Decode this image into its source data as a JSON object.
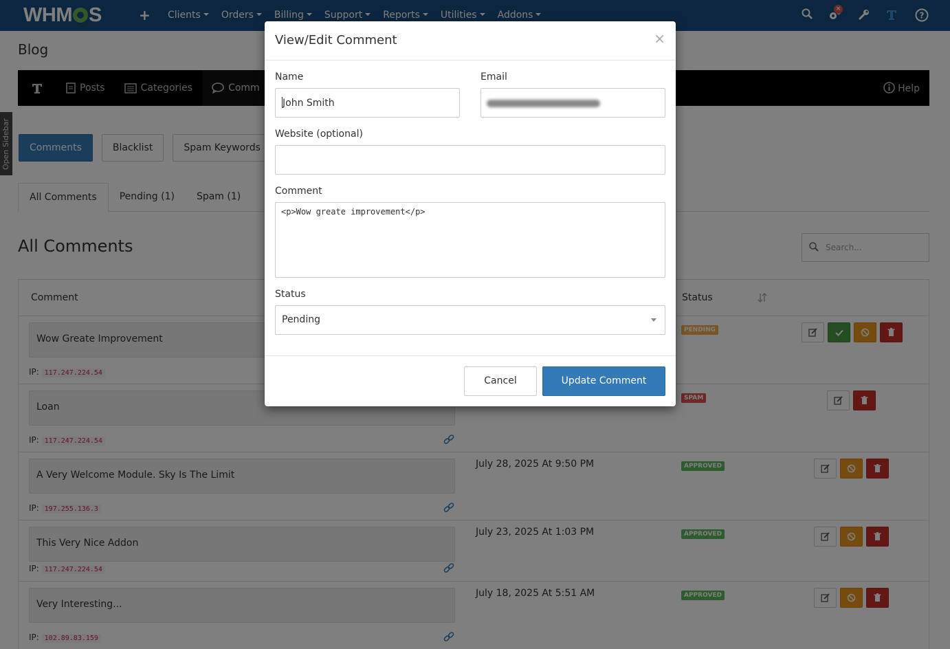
{
  "topnav": {
    "logo": "WHM",
    "logo_end": "S",
    "menu": [
      "Clients",
      "Orders",
      "Billing",
      "Support",
      "Reports",
      "Utilities",
      "Addons"
    ],
    "notification_badge": "×",
    "bg_color": "#1a4d80"
  },
  "page": {
    "title": "Blog",
    "open_sidebar": "Open Sidebar",
    "subnav": {
      "items": [
        "Posts",
        "Categories",
        "Comm"
      ],
      "help": "Help"
    },
    "button_tabs": [
      "Comments",
      "Blacklist",
      "Spam Keywords"
    ],
    "tabs": [
      "All Comments",
      "Pending (1)",
      "Spam (1)"
    ],
    "heading": "All Comments",
    "search_placeholder": "Search...",
    "table": {
      "headers": [
        "Comment",
        "Status"
      ],
      "ip_label": "IP:",
      "rows": [
        {
          "comment": "Wow Greate Improvement",
          "ip": "117.247.224.54",
          "date": "",
          "status": "PENDING",
          "status_color": "#f0ad4e"
        },
        {
          "comment": "Loan",
          "ip": "117.247.224.54",
          "date": "",
          "status": "SPAM",
          "status_color": "#d9534f"
        },
        {
          "comment": "A Very Welcome Module. Sky Is The Limit",
          "ip": "197.255.136.3",
          "date": "July 28, 2025 At 9:50 PM",
          "status": "APPROVED",
          "status_color": "#5cb85c"
        },
        {
          "comment": "This Very Nice Addon",
          "ip": "117.247.224.54",
          "date": "July 23, 2025 At 1:03 PM",
          "status": "APPROVED",
          "status_color": "#5cb85c"
        },
        {
          "comment": "Very Interesting...",
          "ip": "102.89.83.159",
          "date": "July 18, 2025 At 5:51 AM",
          "status": "APPROVED",
          "status_color": "#5cb85c"
        }
      ]
    }
  },
  "modal": {
    "title": "View/Edit Comment",
    "close": "×",
    "name_label": "Name",
    "name_value": "John Smith",
    "email_label": "Email",
    "website_label": "Website (optional)",
    "website_value": "",
    "comment_label": "Comment",
    "comment_value": "<p>Wow greate improvement</p>",
    "status_label": "Status",
    "status_value": "Pending",
    "cancel": "Cancel",
    "update": "Update Comment"
  }
}
